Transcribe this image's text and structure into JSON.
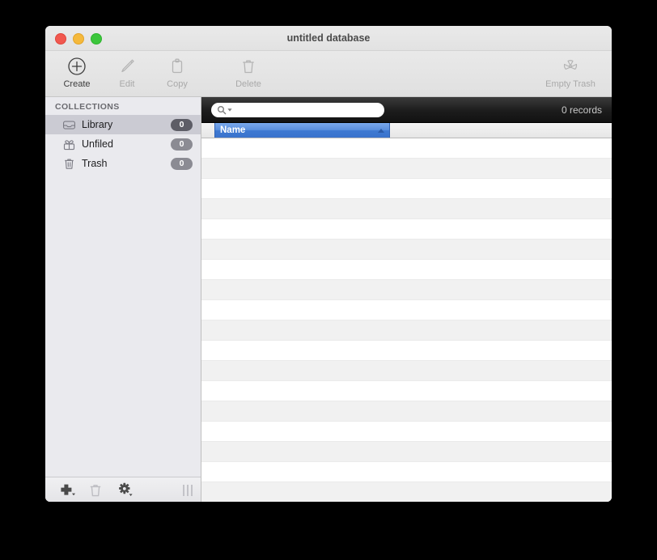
{
  "window": {
    "title": "untitled database",
    "traffic_lights": [
      "close",
      "minimize",
      "maximize"
    ]
  },
  "toolbar": {
    "items": [
      {
        "label": "Create",
        "icon": "plus-circle-icon",
        "enabled": true
      },
      {
        "label": "Edit",
        "icon": "pencil-icon",
        "enabled": false
      },
      {
        "label": "Copy",
        "icon": "clipboard-icon",
        "enabled": false
      },
      {
        "label": "Delete",
        "icon": "trash-icon",
        "enabled": false
      }
    ],
    "empty_trash": {
      "label": "Empty Trash",
      "icon": "radiation-icon",
      "enabled": false
    }
  },
  "sidebar": {
    "header": "COLLECTIONS",
    "items": [
      {
        "label": "Library",
        "count": "0",
        "icon": "inbox-tray-icon",
        "selected": true
      },
      {
        "label": "Unfiled",
        "count": "0",
        "icon": "open-box-icon",
        "selected": false
      },
      {
        "label": "Trash",
        "count": "0",
        "icon": "trash-can-icon",
        "selected": false
      }
    ],
    "footer": {
      "add": "add-collection-icon",
      "delete": "delete-collection-icon",
      "action": "action-gear-icon",
      "grip": "resize-grip"
    }
  },
  "content": {
    "search": {
      "value": "",
      "placeholder": ""
    },
    "records_count": "0 records",
    "columns": [
      {
        "label": "Name",
        "sort": "ascending"
      }
    ],
    "rows": [],
    "empty_row_count": 18
  },
  "colors": {
    "header_blue": "#3f79d2",
    "search_bar_dark": "#1c1c1c",
    "sidebar_bg": "#eaeaee",
    "selected_row": "#cbcbd3",
    "badge_gray": "#8b8b93",
    "stripe_gray": "#f1f1f1"
  }
}
